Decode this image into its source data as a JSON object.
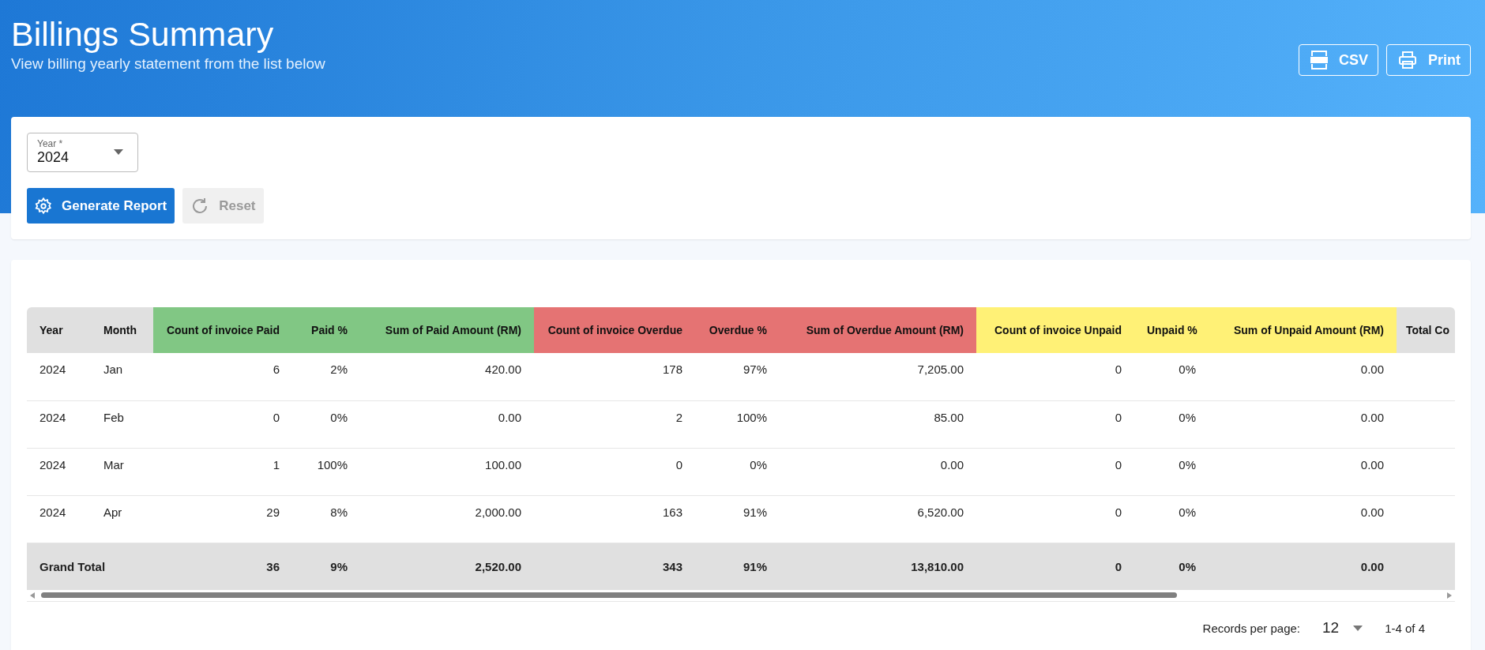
{
  "header": {
    "title": "Billings Summary",
    "subtitle": "View billing yearly statement from the list below",
    "actions": [
      {
        "kind": "csv",
        "label": "CSV"
      },
      {
        "kind": "print",
        "label": "Print"
      }
    ]
  },
  "filters": {
    "year": {
      "label": "Year *",
      "value": "2024"
    },
    "buttons": [
      {
        "kind": "generate",
        "label": "Generate Report",
        "disabled": false
      },
      {
        "kind": "reset",
        "label": "Reset",
        "disabled": true
      }
    ]
  },
  "table": {
    "columns": [
      {
        "label": "Year",
        "kind": "text",
        "color": "#e0e0e0"
      },
      {
        "label": "Month",
        "kind": "text",
        "color": "#e0e0e0"
      },
      {
        "label": "Count of invoice Paid",
        "kind": "number",
        "color": "#81c784"
      },
      {
        "label": "Paid %",
        "kind": "number",
        "color": "#81c784"
      },
      {
        "label": "Sum of Paid Amount (RM)",
        "kind": "number",
        "color": "#81c784"
      },
      {
        "label": "Count of invoice Overdue",
        "kind": "number",
        "color": "#e57373"
      },
      {
        "label": "Overdue %",
        "kind": "number",
        "color": "#e57373"
      },
      {
        "label": "Sum of Overdue Amount (RM)",
        "kind": "number",
        "color": "#e57373"
      },
      {
        "label": "Count of invoice Unpaid",
        "kind": "number",
        "color": "#fff176"
      },
      {
        "label": "Unpaid %",
        "kind": "number",
        "color": "#fff176"
      },
      {
        "label": "Sum of Unpaid Amount (RM)",
        "kind": "number",
        "color": "#fff176"
      },
      {
        "label": "Total Co",
        "kind": "clipped",
        "color": "#e0e0e0"
      }
    ],
    "rows": [
      [
        "2024",
        "Jan",
        "6",
        "2%",
        "420.00",
        "178",
        "97%",
        "7,205.00",
        "0",
        "0%",
        "0.00"
      ],
      [
        "2024",
        "Feb",
        "0",
        "0%",
        "0.00",
        "2",
        "100%",
        "85.00",
        "0",
        "0%",
        "0.00"
      ],
      [
        "2024",
        "Mar",
        "1",
        "100%",
        "100.00",
        "0",
        "0%",
        "0.00",
        "0",
        "0%",
        "0.00"
      ],
      [
        "2024",
        "Apr",
        "29",
        "8%",
        "2,000.00",
        "163",
        "91%",
        "6,520.00",
        "0",
        "0%",
        "0.00"
      ]
    ],
    "grand_total": {
      "label": "Grand Total",
      "cells": [
        "36",
        "9%",
        "2,520.00",
        "343",
        "91%",
        "13,810.00",
        "0",
        "0%",
        "0.00"
      ]
    }
  },
  "pagination": {
    "label": "Records per page:",
    "per_page": "12",
    "range": "1-4 of 4"
  }
}
